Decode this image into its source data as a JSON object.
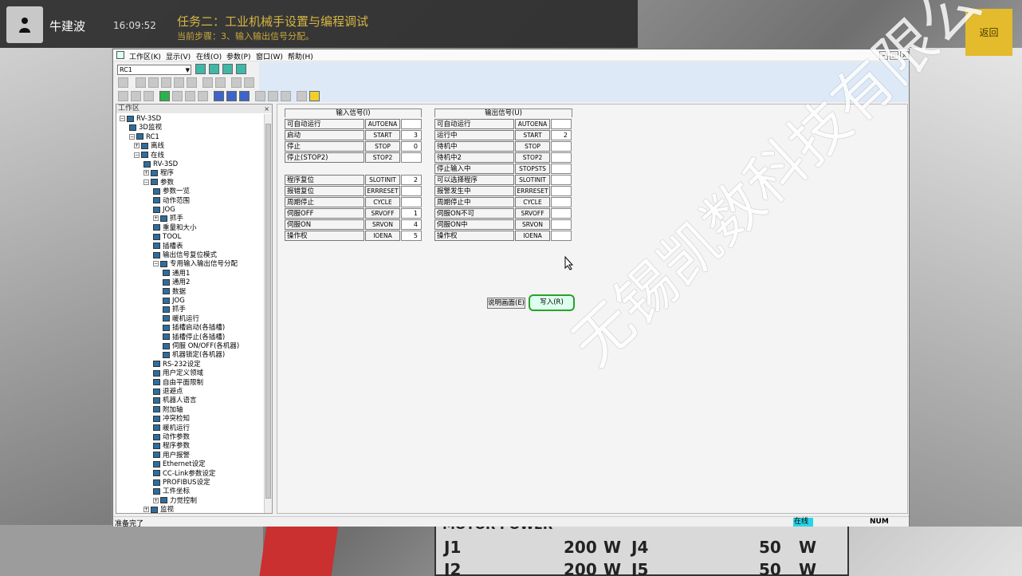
{
  "user": {
    "name": "牛建波",
    "time": "16:09:52"
  },
  "task": {
    "title": "任务二：工业机械手设置与编程调试",
    "step": "当前步骤：3、输入输出信号分配。"
  },
  "back_label": "返回",
  "window": {
    "menu": [
      "工作区(K)",
      "显示(V)",
      "在线(O)",
      "参数(P)",
      "窗口(W)",
      "帮助(H)"
    ],
    "combo_value": "RC1",
    "sidebar_title": "工作区",
    "tree": [
      {
        "label": "RV-3SD",
        "level": 0
      },
      {
        "label": "3D监视",
        "level": 1
      },
      {
        "label": "RC1",
        "level": 1
      },
      {
        "label": "离线",
        "level": 2
      },
      {
        "label": "在线",
        "level": 2
      },
      {
        "label": "RV-3SD",
        "level": 3
      },
      {
        "label": "程序",
        "level": 3
      },
      {
        "label": "参数",
        "level": 3
      },
      {
        "label": "参数一览",
        "level": 4
      },
      {
        "label": "动作范围",
        "level": 4
      },
      {
        "label": "JOG",
        "level": 4
      },
      {
        "label": "抓手",
        "level": 4
      },
      {
        "label": "重量和大小",
        "level": 4
      },
      {
        "label": "TOOL",
        "level": 4
      },
      {
        "label": "插槽表",
        "level": 4
      },
      {
        "label": "输出信号复位模式",
        "level": 4
      },
      {
        "label": "专用输入输出信号分配",
        "level": 4
      },
      {
        "label": "通用1",
        "level": 5
      },
      {
        "label": "通用2",
        "level": 5
      },
      {
        "label": "数据",
        "level": 5
      },
      {
        "label": "JOG",
        "level": 5
      },
      {
        "label": "抓手",
        "level": 5
      },
      {
        "label": "暖机运行",
        "level": 5
      },
      {
        "label": "插槽启动(各插槽)",
        "level": 5
      },
      {
        "label": "插槽停止(各插槽)",
        "level": 5
      },
      {
        "label": "伺服 ON/OFF(各机器)",
        "level": 5
      },
      {
        "label": "机器锁定(各机器)",
        "level": 5
      },
      {
        "label": "RS-232设定",
        "level": 4
      },
      {
        "label": "用户定义领域",
        "level": 4
      },
      {
        "label": "自由平面限制",
        "level": 4
      },
      {
        "label": "退避点",
        "level": 4
      },
      {
        "label": "机器人语言",
        "level": 4
      },
      {
        "label": "附加轴",
        "level": 4
      },
      {
        "label": "冲突检知",
        "level": 4
      },
      {
        "label": "暖机运行",
        "level": 4
      },
      {
        "label": "动作参数",
        "level": 4
      },
      {
        "label": "程序参数",
        "level": 4
      },
      {
        "label": "用户报警",
        "level": 4
      },
      {
        "label": "Ethernet设定",
        "level": 4
      },
      {
        "label": "CC-Link参数设定",
        "level": 4
      },
      {
        "label": "PROFIBUS设定",
        "level": 4
      },
      {
        "label": "工件坐标",
        "level": 4
      },
      {
        "label": "力觉控制",
        "level": 4
      },
      {
        "label": "监视",
        "level": 3
      }
    ],
    "input_title": "输入信号(I)",
    "output_title": "输出信号(U)",
    "inputs1": [
      {
        "label": "可自动运行",
        "code": "AUTOENA",
        "value": ""
      },
      {
        "label": "启动",
        "code": "START",
        "value": "3"
      },
      {
        "label": "停止",
        "code": "STOP",
        "value": "0"
      },
      {
        "label": "停止(STOP2)",
        "code": "STOP2",
        "value": ""
      }
    ],
    "inputs2": [
      {
        "label": "程序复位",
        "code": "SLOTINIT",
        "value": "2"
      },
      {
        "label": "报错复位",
        "code": "ERRRESET",
        "value": ""
      },
      {
        "label": "周期停止",
        "code": "CYCLE",
        "value": ""
      },
      {
        "label": "伺服OFF",
        "code": "SRVOFF",
        "value": "1"
      },
      {
        "label": "伺服ON",
        "code": "SRVON",
        "value": "4"
      },
      {
        "label": "操作权",
        "code": "IOENA",
        "value": "5"
      }
    ],
    "outputs": [
      {
        "label": "可自动运行",
        "code": "AUTOENA",
        "value": ""
      },
      {
        "label": "运行中",
        "code": "START",
        "value": "2"
      },
      {
        "label": "待机中",
        "code": "STOP",
        "value": ""
      },
      {
        "label": "待机中2",
        "code": "STOP2",
        "value": ""
      },
      {
        "label": "停止输入中",
        "code": "STOPSTS",
        "value": ""
      },
      {
        "label": "可以选择程序",
        "code": "SLOTINIT",
        "value": ""
      },
      {
        "label": "报警发生中",
        "code": "ERRRESET",
        "value": ""
      },
      {
        "label": "周期停止中",
        "code": "CYCLE",
        "value": ""
      },
      {
        "label": "伺服ON不可",
        "code": "SRVOFF",
        "value": ""
      },
      {
        "label": "伺服ON中",
        "code": "SRVON",
        "value": ""
      },
      {
        "label": "操作权",
        "code": "IOENA",
        "value": ""
      }
    ],
    "btn_explain": "说明画面(E)",
    "btn_write": "写入(R)",
    "status": {
      "ready": "准备完了",
      "online": "在线",
      "num": "NUM"
    }
  },
  "watermark": "无锡凯数科技有限公司",
  "plate": {
    "title": "MOTOR POWER",
    "rows": [
      [
        "J1",
        "200",
        "W",
        "J4",
        "50",
        "W"
      ],
      [
        "J2",
        "200",
        "W",
        "J5",
        "50",
        "W"
      ]
    ]
  }
}
